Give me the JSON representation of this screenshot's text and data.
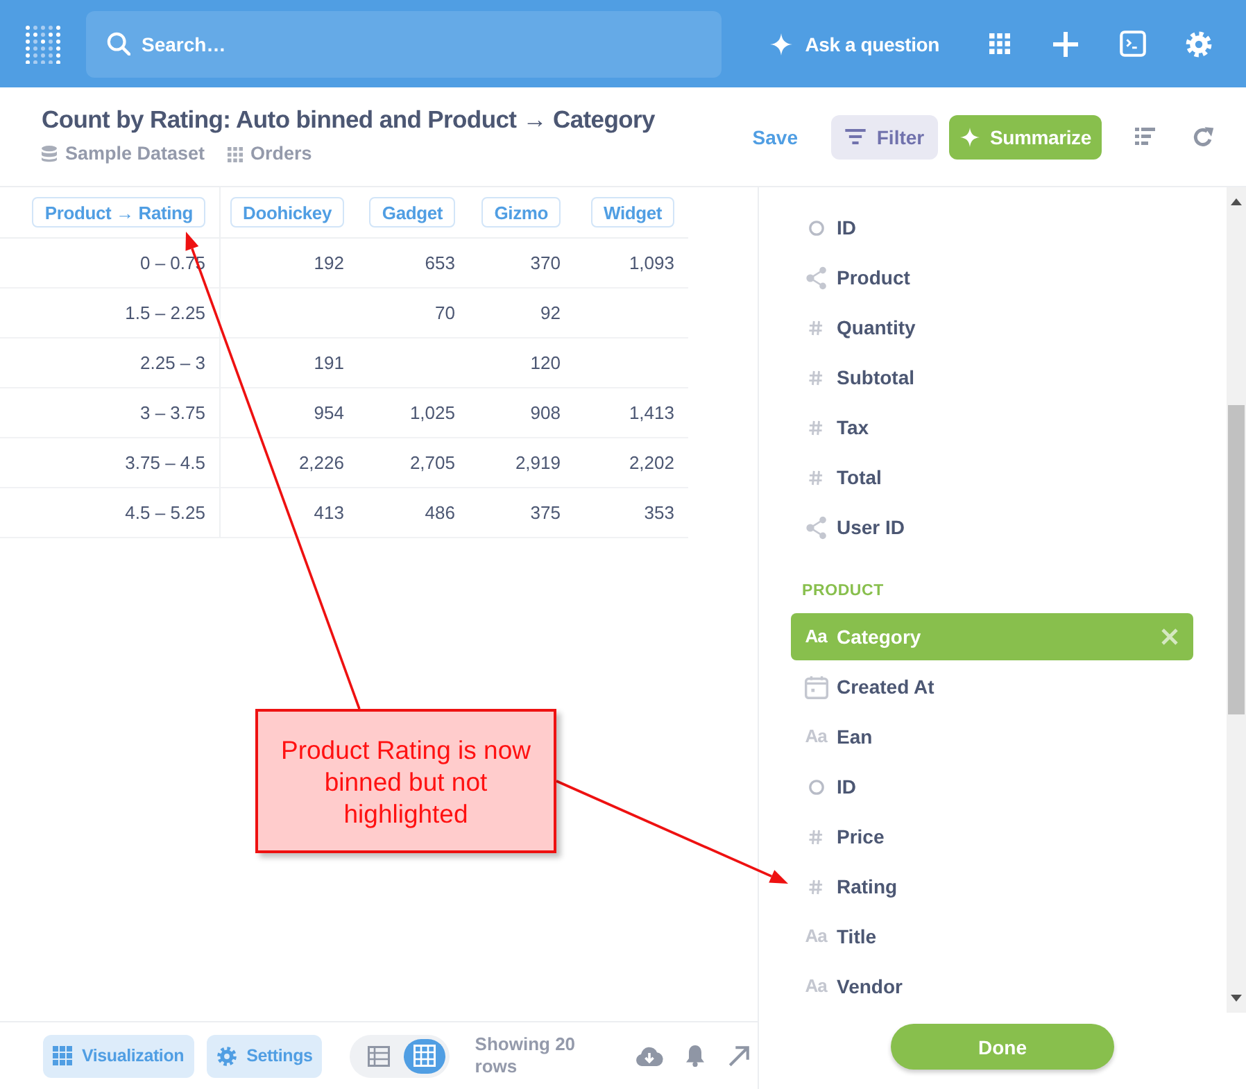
{
  "nav": {
    "search": {
      "placeholder": "Search…"
    },
    "ask_button": "Ask a question"
  },
  "header": {
    "title": "Count by Rating: Auto binned and Product → Category",
    "database": "Sample Dataset",
    "table": "Orders",
    "save_button": "Save",
    "filter_button": "Filter",
    "summarize_button": "Summarize"
  },
  "table": {
    "columns": [
      "Product → Rating",
      "Doohickey",
      "Gadget",
      "Gizmo",
      "Widget"
    ],
    "rows": [
      [
        "0 – 0.75",
        "192",
        "653",
        "370",
        "1,093"
      ],
      [
        "1.5 – 2.25",
        null,
        "70",
        "92",
        null
      ],
      [
        "2.25 – 3",
        "191",
        null,
        "120",
        null
      ],
      [
        "3 – 3.75",
        "954",
        "1,025",
        "908",
        "1,413"
      ],
      [
        "3.75 – 4.5",
        "2,226",
        "2,705",
        "2,919",
        "2,202"
      ],
      [
        "4.5 – 5.25",
        "413",
        "486",
        "375",
        "353"
      ]
    ]
  },
  "sidebar": {
    "groups": [
      {
        "items": [
          {
            "label": "ID",
            "kind": "pk",
            "selected": false
          },
          {
            "label": "Product",
            "kind": "fk",
            "selected": false
          },
          {
            "label": "Quantity",
            "kind": "number",
            "selected": false
          },
          {
            "label": "Subtotal",
            "kind": "number",
            "selected": false
          },
          {
            "label": "Tax",
            "kind": "number",
            "selected": false
          },
          {
            "label": "Total",
            "kind": "number",
            "selected": false
          },
          {
            "label": "User ID",
            "kind": "fk",
            "selected": false
          }
        ]
      },
      {
        "heading": "PRODUCT",
        "items": [
          {
            "label": "Category",
            "kind": "text",
            "glyph": "Aa",
            "selected": true
          },
          {
            "label": "Created At",
            "kind": "date",
            "selected": false
          },
          {
            "label": "Ean",
            "kind": "text",
            "glyph": "Aa",
            "selected": false
          },
          {
            "label": "ID",
            "kind": "pk",
            "selected": false
          },
          {
            "label": "Price",
            "kind": "number",
            "selected": false
          },
          {
            "label": "Rating",
            "kind": "number",
            "selected": false
          },
          {
            "label": "Title",
            "kind": "text",
            "glyph": "Aa",
            "selected": false
          },
          {
            "label": "Vendor",
            "kind": "text",
            "glyph": "Aa",
            "selected": false
          }
        ]
      }
    ],
    "done_button": "Done"
  },
  "footer": {
    "visualization_button": "Visualization",
    "settings_button": "Settings",
    "view_modes": [
      {
        "kind": "table",
        "selected": false
      },
      {
        "kind": "pivot",
        "selected": true
      }
    ],
    "row_count": "Showing 20 rows"
  },
  "annotation": {
    "text": "Product Rating is now binned but not highlighted"
  }
}
